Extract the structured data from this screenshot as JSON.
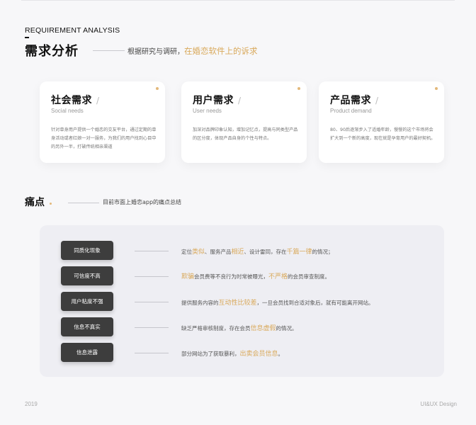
{
  "header": {
    "eyebrow": "REQUIREMENT ANALYSIS",
    "title": "需求分析",
    "subtitle_prefix": "根据研究与调研，",
    "subtitle_highlight": "在婚恋软件上的诉求"
  },
  "cards": [
    {
      "title": "社会需求",
      "slash": "/",
      "en": "Social needs",
      "body": "针对单身用户提供一个婚恋的交友平台，通过定期的单身活动或者红娘一对一服务，为我们的用户找到心目中的另外一半，打破传统相亲渠道"
    },
    {
      "title": "用户需求",
      "slash": "/",
      "en": "User needs",
      "body": "加深对品牌印象认知，增加记忆点，提高与同类型产品的区分度，体现产品自身的个性与特点。"
    },
    {
      "title": "产品需求",
      "slash": "/",
      "en": "Product demand",
      "body": "80、90后逐渐步入了适婚年龄，慢慢的这个市场将会扩大到一个新的高度，现在就是孕育用户的最好契机。"
    }
  ],
  "pain": {
    "title": "痛点",
    "subtitle": "目前市面上婚恋app的痛点总结",
    "rows": [
      {
        "tag": "同质化现象",
        "parts": [
          {
            "t": "定位",
            "h": false
          },
          {
            "t": "类似",
            "h": true
          },
          {
            "t": "、服务产品",
            "h": false
          },
          {
            "t": "相近",
            "h": true
          },
          {
            "t": "、设计雷同，存在",
            "h": false
          },
          {
            "t": "千篇一律",
            "h": true
          },
          {
            "t": "的情况；",
            "h": false
          }
        ]
      },
      {
        "tag": "可信度不高",
        "parts": [
          {
            "t": "欺骗",
            "h": true
          },
          {
            "t": "会员费等不良行为时常被曝光，",
            "h": false
          },
          {
            "t": "不严格",
            "h": true
          },
          {
            "t": "的会员审查制度。",
            "h": false
          }
        ]
      },
      {
        "tag": "用户粘度不强",
        "parts": [
          {
            "t": "提供服务内容的",
            "h": false
          },
          {
            "t": "互动性比较差",
            "h": true
          },
          {
            "t": "，一旦会员找到合适对象后，就有可能离开网站。",
            "h": false
          }
        ]
      },
      {
        "tag": "信息不真实",
        "parts": [
          {
            "t": "缺乏严格审核制度，存在会员",
            "h": false
          },
          {
            "t": "信息虚假",
            "h": true
          },
          {
            "t": "的情况。",
            "h": false
          }
        ]
      },
      {
        "tag": "信息泄露",
        "parts": [
          {
            "t": "部分网站为了获取暴利，",
            "h": false
          },
          {
            "t": "出卖会员信息",
            "h": true
          },
          {
            "t": "。",
            "h": false
          }
        ]
      }
    ]
  },
  "footer": {
    "left": "2019",
    "right": "UI&UX Design"
  }
}
